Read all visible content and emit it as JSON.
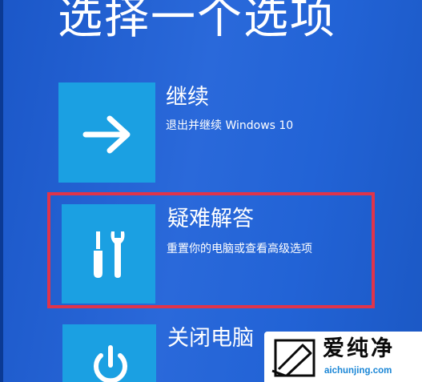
{
  "page": {
    "title": "选择一个选项"
  },
  "options": [
    {
      "title": "继续",
      "description": "退出并继续 Windows 10",
      "icon": "arrow-right-icon"
    },
    {
      "title": "疑难解答",
      "description": "重置你的电脑或查看高级选项",
      "icon": "tools-icon"
    },
    {
      "title": "关闭电脑",
      "icon": "power-icon"
    }
  ],
  "watermark": {
    "brand": "爱纯净",
    "url": "aichunjing.com"
  },
  "colors": {
    "background": "#2263d6",
    "tile": "#1ba0e2",
    "highlight_border": "#e0344a",
    "watermark_url": "#1a86d6"
  }
}
